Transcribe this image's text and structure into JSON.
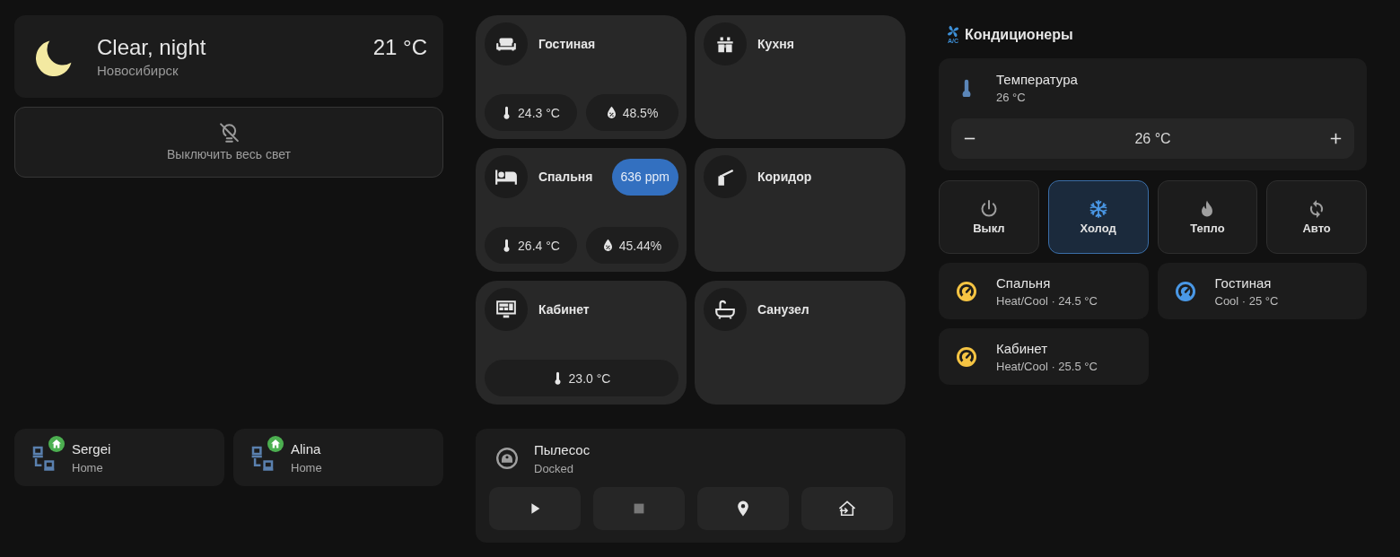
{
  "weather": {
    "condition": "Clear, night",
    "location": "Новосибирск",
    "temperature": "21 °C"
  },
  "lights_off_button": {
    "label": "Выключить весь свет"
  },
  "people": [
    {
      "name": "Sergei",
      "state": "Home"
    },
    {
      "name": "Alina",
      "state": "Home"
    }
  ],
  "rooms": [
    {
      "name": "Гостиная",
      "kind": "sofa",
      "sensors": [
        {
          "kind": "temperature",
          "value": "24.3 °C"
        },
        {
          "kind": "humidity",
          "value": "48.5%"
        }
      ]
    },
    {
      "name": "Кухня",
      "kind": "kitchen"
    },
    {
      "name": "Спальня",
      "kind": "bed",
      "badge": "636 ppm",
      "sensors": [
        {
          "kind": "temperature",
          "value": "26.4 °C"
        },
        {
          "kind": "humidity",
          "value": "45.44%"
        }
      ]
    },
    {
      "name": "Коридор",
      "kind": "barrier"
    },
    {
      "name": "Кабинет",
      "kind": "monitor",
      "sensors": [
        {
          "kind": "temperature",
          "value": "23.0 °C"
        }
      ]
    },
    {
      "name": "Санузел",
      "kind": "bathtub"
    }
  ],
  "vacuum": {
    "name": "Пылесос",
    "state": "Docked",
    "controls": [
      {
        "kind": "play"
      },
      {
        "kind": "stop"
      },
      {
        "kind": "locate"
      },
      {
        "kind": "dock"
      }
    ]
  },
  "climate": {
    "title": "Кондиционеры",
    "icon_text": "A/C",
    "temperature": {
      "label": "Температура",
      "value": "26 °C",
      "setpoint": "26 °C"
    },
    "modes": [
      {
        "kind": "off",
        "label": "Выкл",
        "selected": false
      },
      {
        "kind": "cool",
        "label": "Холод",
        "selected": true
      },
      {
        "kind": "heat",
        "label": "Тепло",
        "selected": false
      },
      {
        "kind": "auto",
        "label": "Авто",
        "selected": false
      }
    ],
    "units": [
      {
        "name": "Спальня",
        "state": "Heat/Cool · 24.5 °C",
        "color": "#f5c443"
      },
      {
        "name": "Гостиная",
        "state": "Cool · 25 °C",
        "color": "#4a98e6"
      },
      {
        "name": "Кабинет",
        "state": "Heat/Cool · 25.5 °C",
        "color": "#f5c443"
      }
    ]
  }
}
